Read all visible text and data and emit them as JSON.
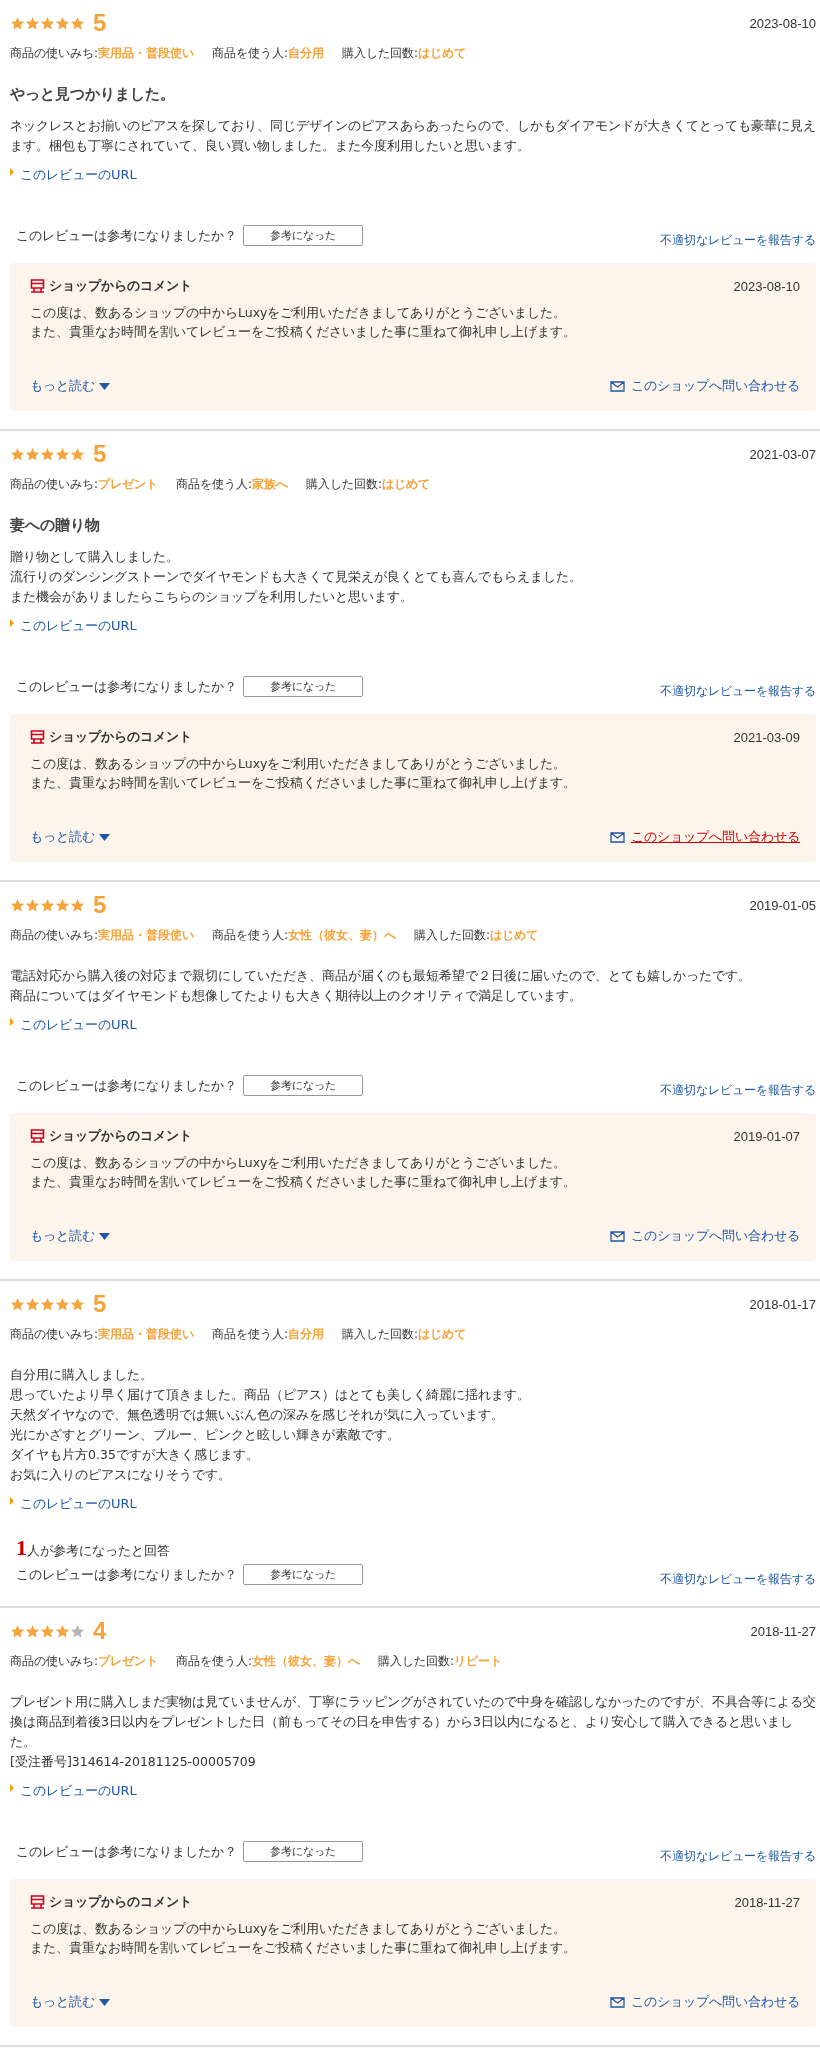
{
  "reviews": [
    {
      "stars": 5,
      "score": "5",
      "date": "2023-08-10",
      "meta": [
        {
          "label": "商品の使いみち:",
          "value": "実用品・普段使い"
        },
        {
          "label": "商品を使う人:",
          "value": "自分用"
        },
        {
          "label": "購入した回数:",
          "value": "はじめて"
        }
      ],
      "title": "やっと見つかりました。",
      "body": [
        "ネックレスとお揃いのピアスを探しており、同じデザインのピアスあらあったらので、しかもダイアモンドが大きくてとっても豪華に見えます。梱包も丁寧にされていて、良い買い物しました。また今度利用したいと思います。"
      ],
      "url_link": "このレビューのURL",
      "question": "このレビューは参考になりましたか？",
      "helpful_button": "参考になった",
      "report_link": "不適切なレビューを報告する",
      "shop_comment": {
        "heading": "ショップからのコメント",
        "date": "2023-08-10",
        "lines": [
          "この度は、数あるショップの中からLuxyをご利用いただきましてありがとうございました。",
          "また、貴重なお時間を割いてレビューをご投稿くださいました事に重ねて御礼申し上げます。"
        ],
        "more_link": "もっと読む",
        "contact_link": "このショップへ問い合わせる",
        "contact_hovered": false
      }
    },
    {
      "stars": 5,
      "score": "5",
      "date": "2021-03-07",
      "meta": [
        {
          "label": "商品の使いみち:",
          "value": "プレゼント"
        },
        {
          "label": "商品を使う人:",
          "value": "家族へ"
        },
        {
          "label": "購入した回数:",
          "value": "はじめて"
        }
      ],
      "title": "妻への贈り物",
      "body": [
        "贈り物として購入しました。",
        "流行りのダンシングストーンでダイヤモンドも大きくて見栄えが良くとても喜んでもらえました。",
        "また機会がありましたらこちらのショップを利用したいと思います。"
      ],
      "url_link": "このレビューのURL",
      "question": "このレビューは参考になりましたか？",
      "helpful_button": "参考になった",
      "report_link": "不適切なレビューを報告する",
      "shop_comment": {
        "heading": "ショップからのコメント",
        "date": "2021-03-09",
        "lines": [
          "この度は、数あるショップの中からLuxyをご利用いただきましてありがとうございました。",
          "また、貴重なお時間を割いてレビューをご投稿くださいました事に重ねて御礼申し上げます。"
        ],
        "more_link": "もっと読む",
        "contact_link": "このショップへ問い合わせる",
        "contact_hovered": true
      }
    },
    {
      "stars": 5,
      "score": "5",
      "date": "2019-01-05",
      "meta": [
        {
          "label": "商品の使いみち:",
          "value": "実用品・普段使い"
        },
        {
          "label": "商品を使う人:",
          "value": "女性（彼女、妻）へ"
        },
        {
          "label": "購入した回数:",
          "value": "はじめて"
        }
      ],
      "body": [
        "電話対応から購入後の対応まで親切にしていただき、商品が届くのも最短希望で２日後に届いたので、とても嬉しかったです。",
        "商品についてはダイヤモンドも想像してたよりも大きく期待以上のクオリティで満足しています。"
      ],
      "url_link": "このレビューのURL",
      "question": "このレビューは参考になりましたか？",
      "helpful_button": "参考になった",
      "report_link": "不適切なレビューを報告する",
      "shop_comment": {
        "heading": "ショップからのコメント",
        "date": "2019-01-07",
        "lines": [
          "この度は、数あるショップの中からLuxyをご利用いただきましてありがとうございました。",
          "また、貴重なお時間を割いてレビューをご投稿くださいました事に重ねて御礼申し上げます。"
        ],
        "more_link": "もっと読む",
        "contact_link": "このショップへ問い合わせる",
        "contact_hovered": false
      }
    },
    {
      "stars": 5,
      "score": "5",
      "date": "2018-01-17",
      "meta": [
        {
          "label": "商品の使いみち:",
          "value": "実用品・普段使い"
        },
        {
          "label": "商品を使う人:",
          "value": "自分用"
        },
        {
          "label": "購入した回数:",
          "value": "はじめて"
        }
      ],
      "body": [
        "自分用に購入しました。",
        "思っていたより早く届けて頂きました。商品（ピアス）はとても美しく綺麗に揺れます。",
        "天然ダイヤなので、無色透明では無いぶん色の深みを感じそれが気に入っています。",
        "光にかざすとグリーン、ブルー、ピンクと眩しい輝きが素敵です。",
        "ダイヤも片方0.35ですが大きく感じます。",
        "お気に入りのピアスになりそうです。"
      ],
      "url_link": "このレビューのURL",
      "helpful_count": "1",
      "helpful_count_text": "人が参考になったと回答",
      "question": "このレビューは参考になりましたか？",
      "helpful_button": "参考になった",
      "report_link": "不適切なレビューを報告する"
    },
    {
      "stars": 4,
      "score": "4",
      "date": "2018-11-27",
      "meta": [
        {
          "label": "商品の使いみち:",
          "value": "プレゼント"
        },
        {
          "label": "商品を使う人:",
          "value": "女性（彼女、妻）へ"
        },
        {
          "label": "購入した回数:",
          "value": "リピート"
        }
      ],
      "body": [
        "プレゼント用に購入しまだ実物は見ていませんが、丁寧にラッピングがされていたので中身を確認しなかったのですが、不具合等による交換は商品到着後3日以内をプレゼントした日（前もってその日を申告する）から3日以内になると、より安心して購入できると思いました。",
        "[受注番号]314614-20181125-00005709"
      ],
      "url_link": "このレビューのURL",
      "question": "このレビューは参考になりましたか？",
      "helpful_button": "参考になった",
      "report_link": "不適切なレビューを報告する",
      "shop_comment": {
        "heading": "ショップからのコメント",
        "date": "2018-11-27",
        "lines": [
          "この度は、数あるショップの中からLuxyをご利用いただきましてありがとうございました。",
          "また、貴重なお時間を割いてレビューをご投稿くださいました事に重ねて御礼申し上げます。"
        ],
        "more_link": "もっと読む",
        "contact_link": "このショップへ問い合わせる",
        "contact_hovered": false
      }
    }
  ]
}
